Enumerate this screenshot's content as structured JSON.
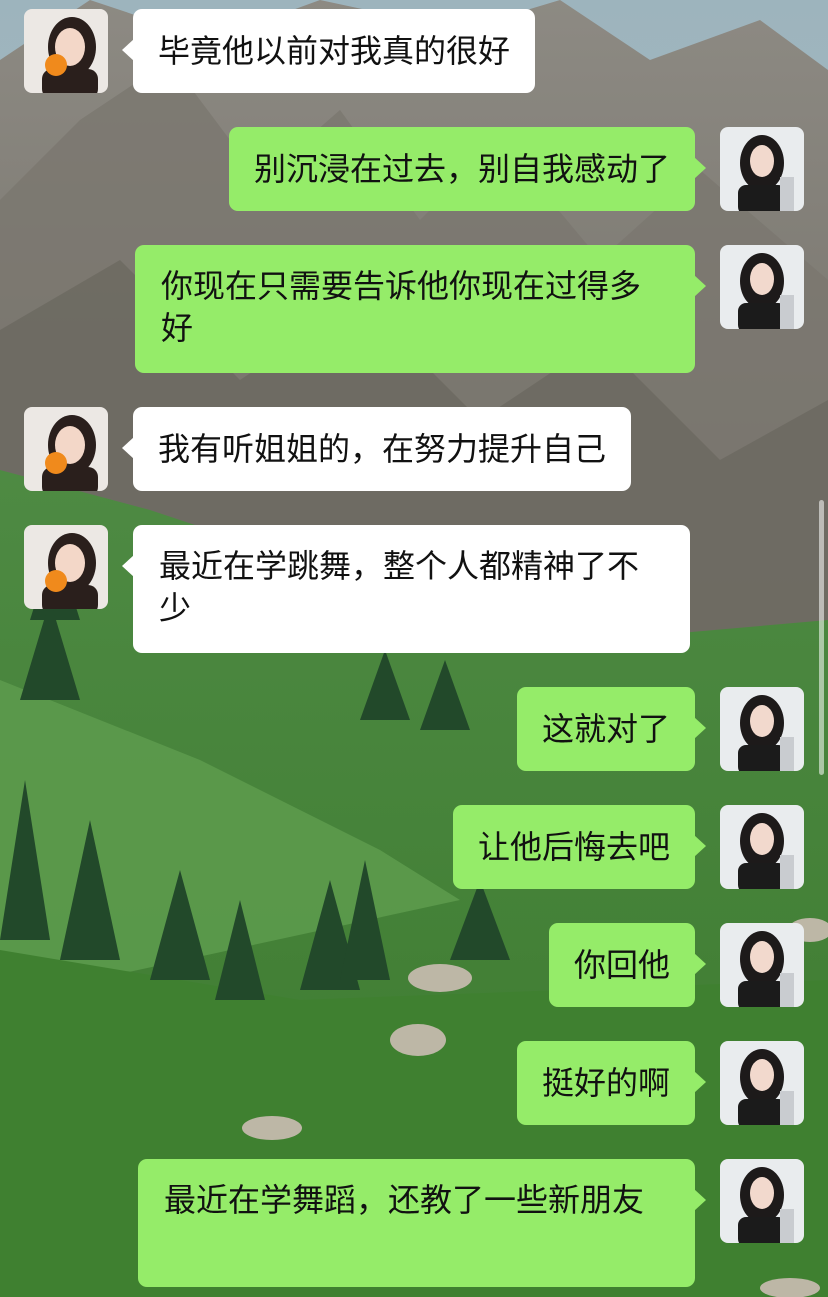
{
  "colors": {
    "received_bubble": "#ffffff",
    "sent_bubble": "#95ec69",
    "text": "#111111"
  },
  "background": {
    "description_icon": "mountain-meadow-wallpaper"
  },
  "avatars": {
    "other": "girl-holding-orange-avatar",
    "self": "woman-black-outfit-avatar"
  },
  "messages": [
    {
      "sender": "other",
      "text": "毕竟他以前对我真的很好"
    },
    {
      "sender": "self",
      "text": "别沉浸在过去，别自我感动了"
    },
    {
      "sender": "self",
      "text": "你现在只需要告诉他你现在过得多好"
    },
    {
      "sender": "other",
      "text": "我有听姐姐的，在努力提升自己"
    },
    {
      "sender": "other",
      "text": "最近在学跳舞，整个人都精神了不少"
    },
    {
      "sender": "self",
      "text": "这就对了"
    },
    {
      "sender": "self",
      "text": "让他后悔去吧"
    },
    {
      "sender": "self",
      "text": "你回他"
    },
    {
      "sender": "self",
      "text": "挺好的啊"
    },
    {
      "sender": "self",
      "text": "最近在学舞蹈，还教了一些新朋友"
    }
  ]
}
